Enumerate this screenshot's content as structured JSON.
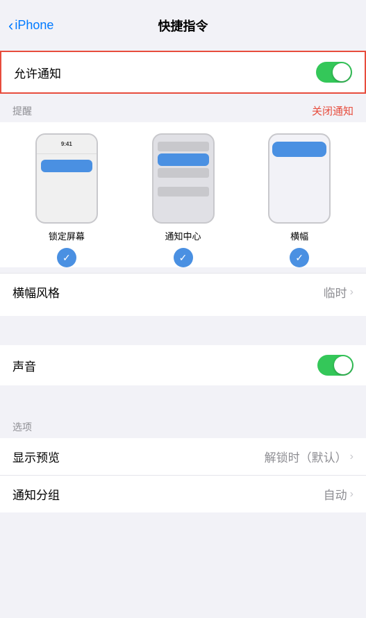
{
  "header": {
    "back_label": "iPhone",
    "title": "快捷指令"
  },
  "allow_notifications": {
    "label": "允许通知",
    "toggle_state": "on"
  },
  "alerts_section": {
    "section_label": "提醒",
    "action_label": "关闭通知",
    "styles": [
      {
        "id": "lock-screen",
        "name": "锁定屏幕",
        "checked": true
      },
      {
        "id": "notification-center",
        "name": "通知中心",
        "checked": true
      },
      {
        "id": "banner",
        "name": "横幅",
        "checked": true
      }
    ]
  },
  "banner_style": {
    "label": "横幅风格",
    "value": "临时",
    "has_chevron": true
  },
  "sounds": {
    "label": "声音",
    "toggle_state": "on"
  },
  "options_section": {
    "section_label": "选项",
    "rows": [
      {
        "label": "显示预览",
        "value": "解锁时（默认）",
        "has_chevron": true
      },
      {
        "label": "通知分组",
        "value": "自动",
        "has_chevron": true
      }
    ]
  }
}
